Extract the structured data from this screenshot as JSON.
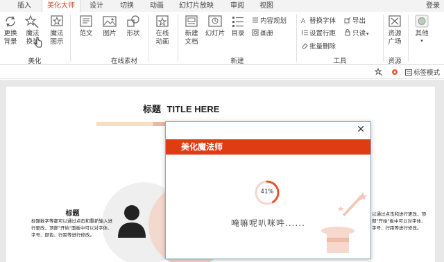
{
  "tabs": [
    {
      "label": "插入"
    },
    {
      "label": "美化大师"
    },
    {
      "label": "设计"
    },
    {
      "label": "切换"
    },
    {
      "label": "动画"
    },
    {
      "label": "幻灯片放映"
    },
    {
      "label": "审阅"
    },
    {
      "label": "视图"
    }
  ],
  "login_label": "登录",
  "ribbon": {
    "meihua": {
      "group": "美化",
      "change_bg": "更换\n背景",
      "magic_replace": "魔法\n换装",
      "magic_diagram": "魔法\n图示"
    },
    "online": {
      "group": "在线素材",
      "template": "范文",
      "picture": "图片",
      "shape": "形状",
      "online_anim": "在线\n动画"
    },
    "create": {
      "group": "新建",
      "new_doc": "新建\n文档",
      "slide": "幻灯片",
      "toc": "目录",
      "content_plan": "内容规划",
      "album": "画册"
    },
    "tools": {
      "group": "工具",
      "replace_font": "替换字体",
      "line_spacing": "设置行距",
      "batch_delete": "批量删除",
      "export": "导出",
      "readonly": "只读"
    },
    "resources": {
      "group": "资源",
      "resource_square": "资源\n广场",
      "other": "其他"
    }
  },
  "subbar": {
    "label_mode": "标签模式"
  },
  "slide": {
    "title": "标题",
    "title_en": "TITLE HERE",
    "left_heading": "标题",
    "left_body": "标题数字等都可以通过点击和重新输入进行更改，顶部\"开始\"面板中可以对字体、字号、颜色、行距等进行修改。",
    "right_body": "以通过点击和进行更改，顶部\"开始\"板中可以对字体、字号、行距等进行修改。"
  },
  "dialog": {
    "title": "美化魔法师",
    "progress_percent": 41,
    "progress_label": "41%",
    "loading_text": "唵嘛呢叭咪吽......"
  },
  "colors": {
    "accent": "#d24726",
    "dialog_header": "#e03c14",
    "spinner": "#e8552c"
  }
}
